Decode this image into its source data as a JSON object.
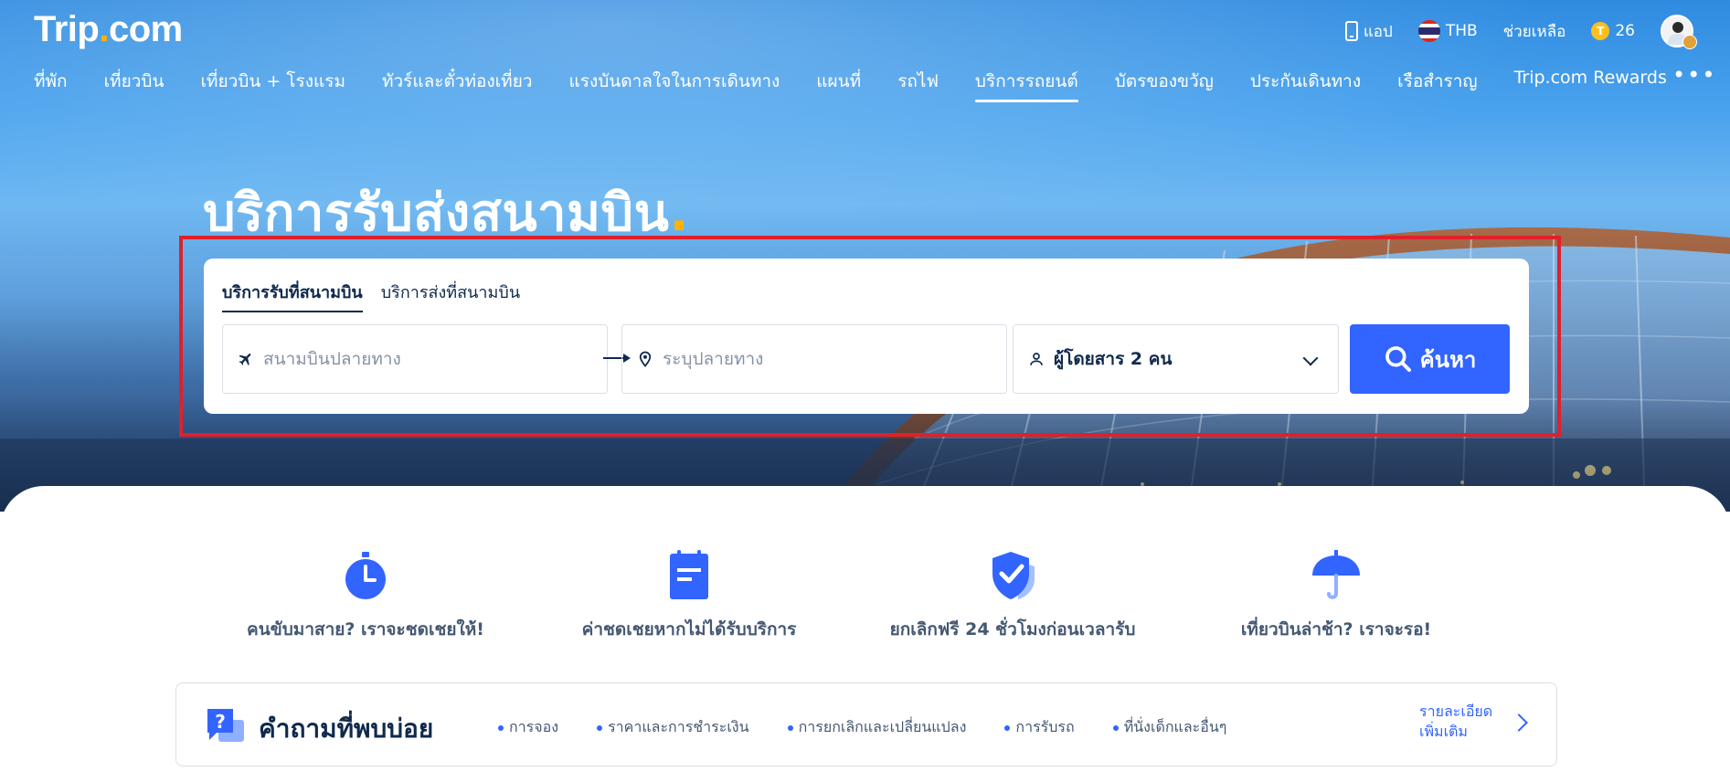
{
  "header": {
    "logo_text": "Trip",
    "logo_dot": ".",
    "logo_suffix": "com",
    "app_label": "แอป",
    "currency": "THB",
    "help_label": "ช่วยเหลือ",
    "coin_symbol": "T",
    "coins": "26"
  },
  "nav": {
    "items": [
      {
        "label": "ที่พัก"
      },
      {
        "label": "เที่ยวบิน"
      },
      {
        "label": "เที่ยวบิน + โรงแรม"
      },
      {
        "label": "ทัวร์และตั๋วท่องเที่ยว"
      },
      {
        "label": "แรงบันดาลใจในการเดินทาง"
      },
      {
        "label": "แผนที่"
      },
      {
        "label": "รถไฟ"
      },
      {
        "label": "บริการรถยนต์"
      },
      {
        "label": "บัตรของขวัญ"
      },
      {
        "label": "ประกันเดินทาง"
      },
      {
        "label": "เรือสำราญ"
      },
      {
        "label": "Trip.com Rewards"
      }
    ],
    "active_index": 7,
    "more_label": "•••"
  },
  "hero": {
    "headline": "บริการรับส่งสนามบิน",
    "headline_dot": "."
  },
  "search": {
    "tabs": [
      {
        "label": "บริการรับที่สนามบิน"
      },
      {
        "label": "บริการส่งที่สนามบิน"
      }
    ],
    "active_tab": 0,
    "from_placeholder": "สนามบินปลายทาง",
    "to_placeholder": "ระบุปลายทาง",
    "passengers": "ผู้โดยสาร 2 คน",
    "button_label": "ค้นหา"
  },
  "features": [
    {
      "label": "คนขับมาสาย? เราจะชดเชยให้!",
      "icon": "stopwatch-icon"
    },
    {
      "label": "ค่าชดเชยหากไม่ได้รับบริการ",
      "icon": "notepad-icon"
    },
    {
      "label": "ยกเลิกฟรี 24 ชั่วโมงก่อนเวลารับ",
      "icon": "shield-check-icon"
    },
    {
      "label": "เที่ยวบินล่าช้า? เราจะรอ!",
      "icon": "umbrella-icon"
    }
  ],
  "faq": {
    "title": "คำถามที่พบบ่อย",
    "links": [
      {
        "label": "การจอง"
      },
      {
        "label": "ราคาและการชำระเงิน"
      },
      {
        "label": "การยกเลิกและเปลี่ยนแปลง"
      },
      {
        "label": "การรับรถ"
      },
      {
        "label": "ที่นั่งเด็กและอื่นๆ"
      }
    ],
    "more_line1": "รายละเอียด",
    "more_line2": "เพิ่มเติม"
  },
  "colors": {
    "accent": "#3264ff",
    "highlight": "#e0202a",
    "logo_dot": "#ffb300",
    "text_dark": "#0f294d"
  }
}
